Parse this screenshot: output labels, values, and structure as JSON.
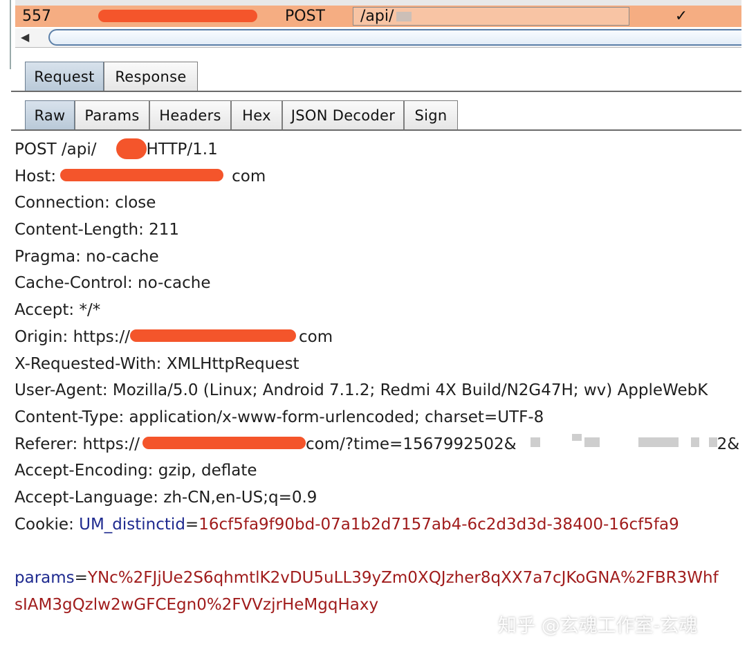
{
  "history_row": {
    "number": "557",
    "method": "POST",
    "url": "/api/",
    "checked": "✓"
  },
  "tabs_primary": [
    "Request",
    "Response"
  ],
  "tabs_secondary": [
    "Raw",
    "Params",
    "Headers",
    "Hex",
    "JSON Decoder",
    "Sign"
  ],
  "raw": {
    "request_line_a": "POST /api/",
    "request_line_b": "HTTP/1.1",
    "host_label": "Host:",
    "host_suffix": "com",
    "connection": "Connection: close",
    "content_length": "Content-Length: 211",
    "pragma": "Pragma: no-cache",
    "cache_control": "Cache-Control: no-cache",
    "accept": "Accept: */*",
    "origin_label": "Origin: https://",
    "origin_suffix": "com",
    "x_requested_with": "X-Requested-With: XMLHttpRequest",
    "user_agent": "User-Agent: Mozilla/5.0 (Linux; Android 7.1.2; Redmi 4X Build/N2G47H; wv) AppleWebK",
    "content_type": "Content-Type: application/x-www-form-urlencoded; charset=UTF-8",
    "referer_label": "Referer: https://",
    "referer_suffix": "com/?time=1567992502&",
    "referer_tail": "2&",
    "accept_encoding": "Accept-Encoding: gzip, deflate",
    "accept_language": "Accept-Language: zh-CN,en-US;q=0.9",
    "cookie_label": "Cookie: ",
    "cookie_name": "UM_distinctid",
    "cookie_eq": "=",
    "cookie_value": "16cf5fa9f90bd-07a1b2d7157ab4-6c2d3d3d-38400-16cf5fa9",
    "params_name": "params",
    "params_eq": "=",
    "params_value_1": "YNc%2FJjUe2S6qhmtlK2vDU5uLL39yZm0XQJzher8qXX7a7cJKoGNA%2FBR3Whf",
    "params_value_2": "sIAM3gQzlw2wGFCEgn0%2FVVzjrHeMgqHaxy"
  },
  "watermark": "知乎 @玄魂工作室-玄魂",
  "colors": {
    "highlight_row": "#f5ad82",
    "redaction": "#f4552b",
    "param_name": "#1e2a8f",
    "param_value": "#a01c1c"
  }
}
